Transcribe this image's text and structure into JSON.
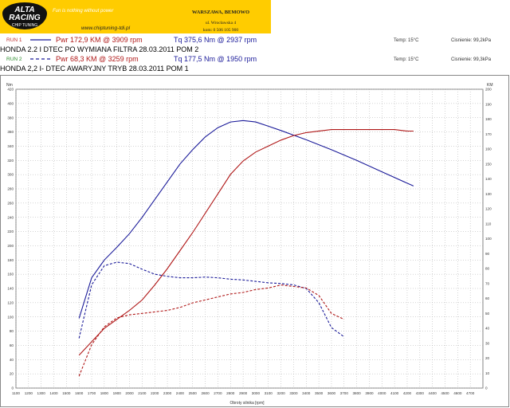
{
  "banner": {
    "logo_line1": "ALTA",
    "logo_line2": "RACING",
    "logo_line3": "CHIP TUNING",
    "slogan": "Fun is nothing without power",
    "website": "www.chiptuning-tdi.pl",
    "city": "WARSZAWA, BEMOWO",
    "street": "ul. Wrocławska 4",
    "phone": "kom: 0 506 105 900"
  },
  "run1": {
    "label": "RUN 1",
    "power": "Pwr 172,9 KM @ 3909 rpm",
    "torque": "Tq 375,6 Nm @ 2937 rpm",
    "temp": "Temp: 15°C",
    "pressure": "Cisnienie: 99,2kPa",
    "description": "HONDA 2.2 I DTEC  PO WYMIANA FILTRA 28.03.2011  POM 2",
    "color": "#1a1a99"
  },
  "run2": {
    "label": "RUN 2",
    "power": "Pwr 68,3 KM @ 3259 rpm",
    "torque": "Tq 177,5 Nm @ 1950 rpm",
    "temp": "Temp: 15°C",
    "pressure": "Cisnienie: 99,3kPa",
    "description": "HONDA  2,2 I- DTEC   AWARYJNY TRYB  28.03.2011  POM 1",
    "color": "#b01818"
  },
  "chart_data": {
    "type": "line",
    "xlabel": "Obroty silnika [rpm]",
    "ylabel_left": "Nm",
    "ylabel_right": "KM",
    "xlim": [
      1100,
      4800
    ],
    "ylim_left": [
      0,
      420
    ],
    "ylim_right": [
      0,
      200
    ],
    "grid": true,
    "x_ticks": [
      1100,
      1200,
      1300,
      1400,
      1500,
      1600,
      1700,
      1800,
      1900,
      2000,
      2100,
      2200,
      2300,
      2400,
      2500,
      2600,
      2700,
      2800,
      2900,
      3000,
      3100,
      3200,
      3300,
      3400,
      3500,
      3600,
      3700,
      3800,
      3900,
      4000,
      4100,
      4200,
      4300,
      4400,
      4500,
      4600,
      4700
    ],
    "y_ticks_left": [
      0,
      20,
      40,
      60,
      80,
      100,
      120,
      140,
      160,
      180,
      200,
      220,
      240,
      260,
      280,
      300,
      320,
      340,
      360,
      380,
      400,
      420
    ],
    "y_ticks_right": [
      0,
      10,
      20,
      30,
      40,
      50,
      60,
      70,
      80,
      90,
      100,
      110,
      120,
      130,
      140,
      150,
      160,
      170,
      180,
      190,
      200
    ],
    "series": [
      {
        "name": "RUN 1",
        "metric": "torque",
        "axis": "left",
        "style": "solid",
        "color": "#1a1a99",
        "x": [
          1600,
          1700,
          1800,
          1900,
          2000,
          2100,
          2200,
          2300,
          2400,
          2500,
          2600,
          2700,
          2800,
          2900,
          3000,
          3100,
          3200,
          3400,
          3600,
          3800,
          4000,
          4200,
          4250
        ],
        "y": [
          98,
          155,
          180,
          198,
          217,
          240,
          265,
          290,
          315,
          335,
          353,
          366,
          374,
          376,
          374,
          368,
          362,
          349,
          335,
          320,
          304,
          288,
          284
        ]
      },
      {
        "name": "RUN 1",
        "metric": "power",
        "axis": "right",
        "style": "solid",
        "color": "#b01818",
        "x": [
          1600,
          1700,
          1800,
          1900,
          2000,
          2100,
          2200,
          2300,
          2400,
          2500,
          2600,
          2700,
          2800,
          2900,
          3000,
          3100,
          3200,
          3300,
          3400,
          3600,
          3800,
          3900,
          4000,
          4100,
          4200,
          4250
        ],
        "y": [
          22,
          31,
          40,
          46,
          52,
          59,
          69,
          80,
          92,
          104,
          117,
          130,
          143,
          152,
          158,
          162,
          166,
          169,
          171,
          173,
          173,
          173,
          173,
          173,
          172,
          172
        ]
      },
      {
        "name": "RUN 2",
        "metric": "torque",
        "axis": "left",
        "style": "dashed",
        "color": "#1a1a99",
        "x": [
          1600,
          1700,
          1800,
          1900,
          2000,
          2100,
          2200,
          2300,
          2400,
          2500,
          2600,
          2700,
          2800,
          2900,
          3000,
          3100,
          3200,
          3300,
          3400,
          3500,
          3600,
          3700
        ],
        "y": [
          70,
          145,
          172,
          177,
          175,
          167,
          160,
          157,
          155,
          155,
          156,
          155,
          153,
          152,
          150,
          148,
          147,
          145,
          140,
          120,
          85,
          72
        ]
      },
      {
        "name": "RUN 2",
        "metric": "power",
        "axis": "right",
        "style": "dashed",
        "color": "#b01818",
        "x": [
          1600,
          1700,
          1800,
          1900,
          2000,
          2100,
          2200,
          2300,
          2400,
          2500,
          2600,
          2700,
          2800,
          2900,
          3000,
          3100,
          3200,
          3300,
          3400,
          3500,
          3600,
          3700
        ],
        "y": [
          8,
          29,
          41,
          47,
          49,
          50,
          51,
          52,
          54,
          57,
          59,
          61,
          63,
          64,
          66,
          67,
          69,
          68,
          67,
          62,
          50,
          46
        ]
      }
    ]
  }
}
